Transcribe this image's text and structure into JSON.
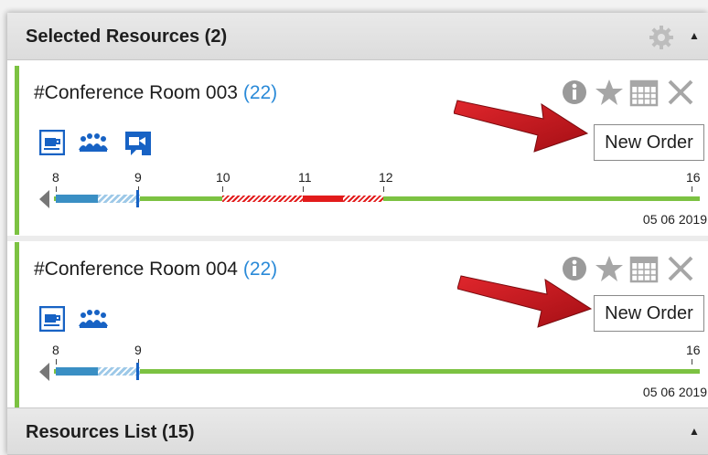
{
  "selected_resources": {
    "title": "Selected Resources (2)"
  },
  "resources_list": {
    "title": "Resources List (15)"
  },
  "cards": [
    {
      "name": "#Conference Room 003",
      "count": "(22)",
      "features": [
        "coffee-icon",
        "meeting-people-icon",
        "video-conference-icon"
      ],
      "new_order_label": "New Order",
      "ticks": [
        "8",
        "9",
        "10",
        "11",
        "12",
        "16"
      ],
      "date": "05 06 2019"
    },
    {
      "name": "#Conference Room 004",
      "count": "(22)",
      "features": [
        "coffee-icon",
        "meeting-people-icon"
      ],
      "new_order_label": "New Order",
      "ticks": [
        "8",
        "9",
        "16"
      ],
      "date": "05 06 2019"
    }
  ],
  "colors": {
    "accent_green": "#7cc242",
    "link_blue": "#2a8ad8",
    "icon_blue": "#1762c4",
    "busy_red": "#e21b1b",
    "arrow_red": "#c8161d"
  }
}
